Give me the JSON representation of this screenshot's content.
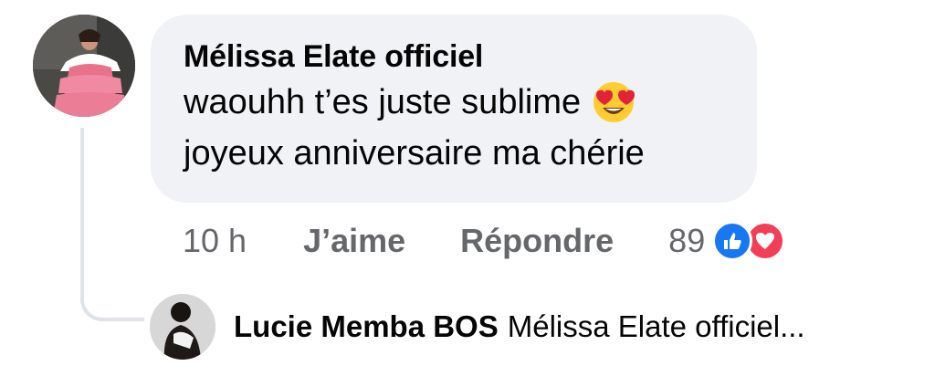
{
  "comment": {
    "author": "Mélissa Elate officiel",
    "line1": "waouhh t’es juste sublime",
    "line1_emoji": "heart-eyes-emoji",
    "line2": "joyeux anniversaire ma chérie",
    "time": "10 h",
    "like_label": "J’aime",
    "reply_label": "Répondre",
    "reaction_count": "89",
    "reactions": [
      "like-reaction-icon",
      "love-reaction-icon"
    ]
  },
  "reply": {
    "author": "Lucie Memba BOS",
    "preview": "Mélissa Elate officiel..."
  },
  "colors": {
    "bubble": "#f0f2f5",
    "meta_text": "#65676b",
    "like_blue": "#1877f2",
    "love_red": "#f33e58"
  }
}
